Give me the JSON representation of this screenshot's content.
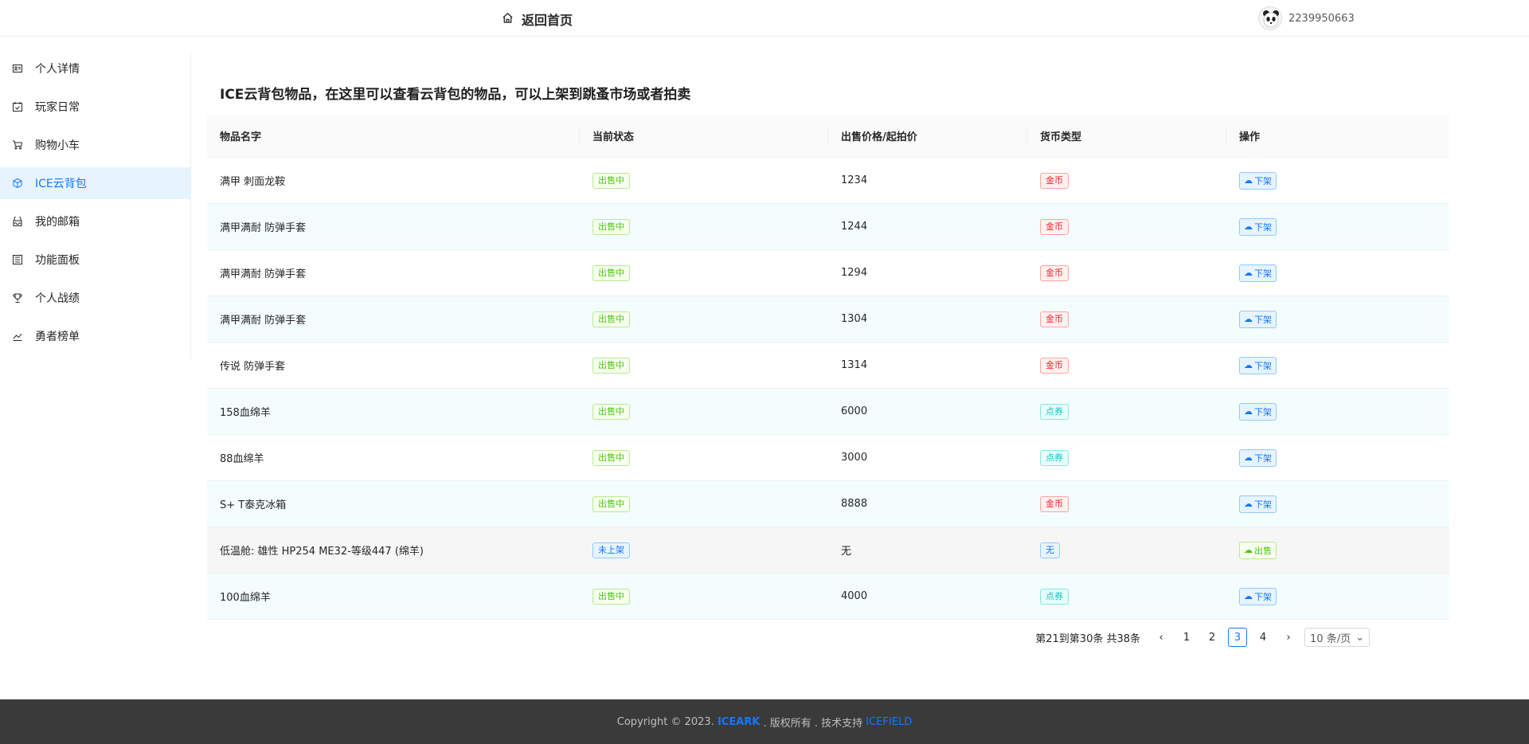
{
  "header": {
    "home_label": "返回首页",
    "username": "2239950663"
  },
  "sidebar": {
    "items": [
      {
        "label": "个人详情",
        "icon": "id-card-icon"
      },
      {
        "label": "玩家日常",
        "icon": "calendar-check-icon"
      },
      {
        "label": "购物小车",
        "icon": "cart-icon"
      },
      {
        "label": "ICE云背包",
        "icon": "cube-icon",
        "active": true
      },
      {
        "label": "我的邮箱",
        "icon": "mailbox-icon"
      },
      {
        "label": "功能面板",
        "icon": "panel-icon"
      },
      {
        "label": "个人战绩",
        "icon": "trophy-icon"
      },
      {
        "label": "勇者榜单",
        "icon": "line-chart-icon"
      }
    ]
  },
  "page": {
    "title": "ICE云背包物品，在这里可以查看云背包的物品，可以上架到跳蚤市场或者拍卖"
  },
  "table": {
    "headers": [
      "物品名字",
      "当前状态",
      "出售价格/起拍价",
      "货币类型",
      "操作"
    ],
    "rows": [
      {
        "name": "满甲 刺面龙鞍",
        "status": "出售中",
        "price": "1234",
        "currency": "金币",
        "action": "下架"
      },
      {
        "name": "满甲满耐 防弹手套",
        "status": "出售中",
        "price": "1244",
        "currency": "金币",
        "action": "下架"
      },
      {
        "name": "满甲满耐 防弹手套",
        "status": "出售中",
        "price": "1294",
        "currency": "金币",
        "action": "下架"
      },
      {
        "name": "满甲满耐 防弹手套",
        "status": "出售中",
        "price": "1304",
        "currency": "金币",
        "action": "下架"
      },
      {
        "name": "传说 防弹手套",
        "status": "出售中",
        "price": "1314",
        "currency": "金币",
        "action": "下架"
      },
      {
        "name": "158血绵羊",
        "status": "出售中",
        "price": "6000",
        "currency": "点券",
        "action": "下架"
      },
      {
        "name": "88血绵羊",
        "status": "出售中",
        "price": "3000",
        "currency": "点券",
        "action": "下架"
      },
      {
        "name": "S+ T泰克冰箱",
        "status": "出售中",
        "price": "8888",
        "currency": "金币",
        "action": "下架"
      },
      {
        "name": "低温舱: 雄性 HP254 ME32-等级447 (绵羊)",
        "status": "未上架",
        "price": "无",
        "currency": "无",
        "action": "出售"
      },
      {
        "name": "100血绵羊",
        "status": "出售中",
        "price": "4000",
        "currency": "点券",
        "action": "下架"
      }
    ]
  },
  "pagination": {
    "total_text": "第21到第30条 共38条",
    "pages": [
      "1",
      "2",
      "3",
      "4"
    ],
    "current": "3",
    "page_size": "10 条/页"
  },
  "footer": {
    "prefix": "Copyright © 2023.",
    "brand": "ICEARK",
    "middle": ". 版权所有 . 技术支持",
    "link": "ICEFIELD"
  },
  "colors": {
    "accent": "#1677ff",
    "selling": "#52c41a",
    "gold": "#f5222d",
    "points": "#13c2c2",
    "footer_bg": "#3a3a3a"
  }
}
